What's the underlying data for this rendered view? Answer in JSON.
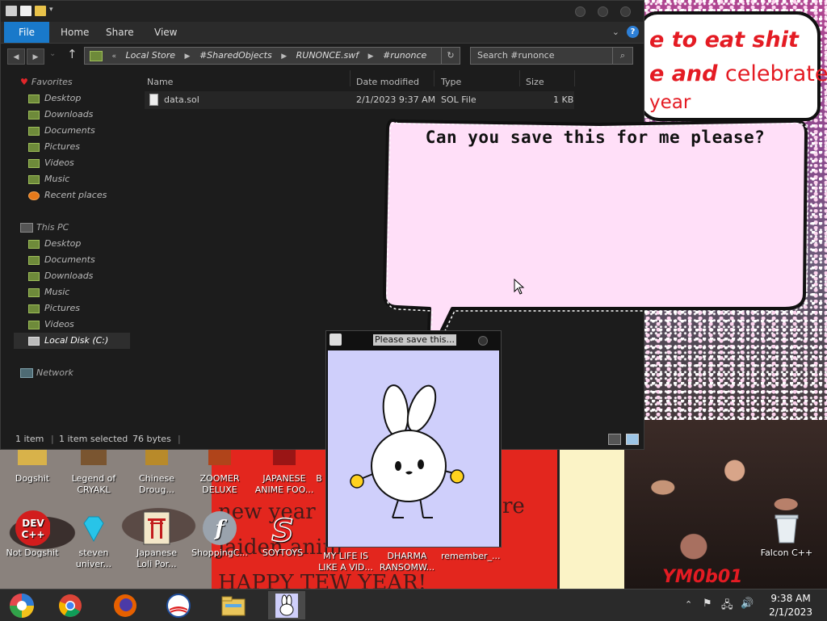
{
  "wallpaper": {
    "banner_line1": "e to eat shit",
    "banner_line2_bold": "e and",
    "banner_line2_plain": "celebrate",
    "banner_line3": "year",
    "red_text_1": "new year",
    "red_text_2": "jaiden anim",
    "red_text_3": "HAPPY TEW YEAR!",
    "red_text_right": "re",
    "tag": "YM0b01"
  },
  "desktop_icons": [
    {
      "label": "Dogshit"
    },
    {
      "label": "Legend of CRYAKL"
    },
    {
      "label": "Chinese Droug..."
    },
    {
      "label": "ZOOMER DELUXE"
    },
    {
      "label": "JAPANESE ANIME FOO..."
    },
    {
      "label": "B"
    },
    {
      "label": "Not Dogshit",
      "badge": "DEV C++"
    },
    {
      "label": "steven univer..."
    },
    {
      "label": "Japanese Loli Por..."
    },
    {
      "label": "ShoppingC..."
    },
    {
      "label": "SOYTOYS"
    },
    {
      "label": "MY LIFE IS LIKE A VID..."
    },
    {
      "label": "DHARMA RANSOMW..."
    },
    {
      "label": "remember_..."
    },
    {
      "label": "Falcon C++"
    }
  ],
  "explorer": {
    "ribbon": {
      "file": "File",
      "home": "Home",
      "share": "Share",
      "view": "View",
      "help": "?"
    },
    "address": {
      "prefix": "«",
      "crumbs": [
        "Local Store",
        "#SharedObjects",
        "RUNONCE.swf",
        "#runonce"
      ]
    },
    "search": {
      "placeholder": "Search #runonce"
    },
    "nav": {
      "favorites": "Favorites",
      "fav_items": [
        "Desktop",
        "Downloads",
        "Documents",
        "Pictures",
        "Videos",
        "Music",
        "Recent places"
      ],
      "this_pc": "This PC",
      "pc_items": [
        "Desktop",
        "Documents",
        "Downloads",
        "Music",
        "Pictures",
        "Videos",
        "Local Disk (C:)"
      ],
      "network": "Network"
    },
    "columns": {
      "name": "Name",
      "date": "Date modified",
      "type": "Type",
      "size": "Size"
    },
    "files": [
      {
        "name": "data.sol",
        "date": "2/1/2023 9:37 AM",
        "type": "SOL File",
        "size": "1 KB"
      }
    ],
    "status": {
      "count": "1 item",
      "selected": "1 item selected",
      "bytes": "76 bytes"
    }
  },
  "bubble": {
    "text": "Can you save this for me please?"
  },
  "dialog": {
    "title": "Please save this..."
  },
  "taskbar": {
    "apps": [
      "chrome-like",
      "chrome",
      "firefox",
      "obama",
      "explorer",
      "bunny"
    ],
    "clock_time": "9:38 AM",
    "clock_date": "2/1/2023"
  }
}
